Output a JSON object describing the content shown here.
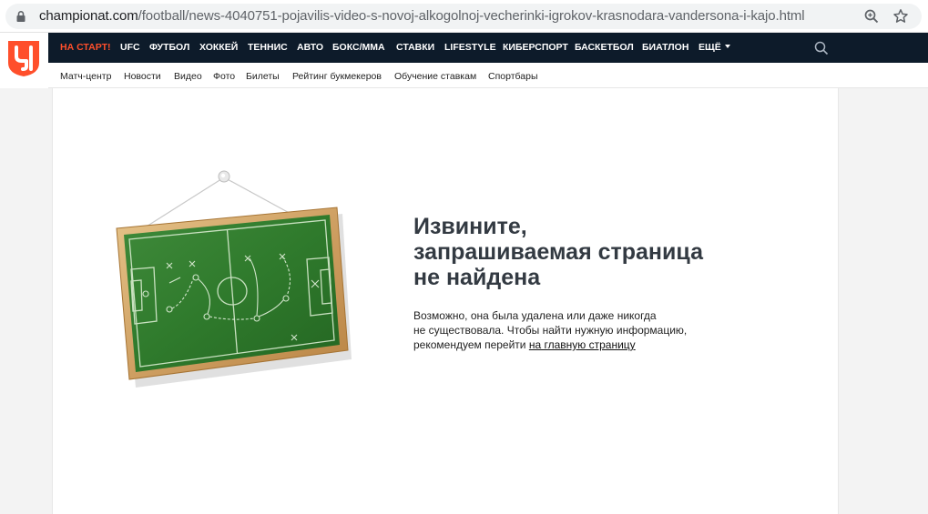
{
  "browser": {
    "url_host": "championat.com",
    "url_path": "/football/news-4040751-pojavilis-video-s-novoj-alkogolnoj-vecherinki-igrokov-krasnodara-vandersona-i-kajo.html",
    "icons": [
      "lock-icon",
      "zoom-icon",
      "star-icon"
    ]
  },
  "site": {
    "logo_icon": "championat-logo",
    "brand_color": "#ff4f2b",
    "nav_bg": "#0d1b2a",
    "nav": [
      {
        "label": "НА СТАРТ!"
      },
      {
        "label": "UFC"
      },
      {
        "label": "ФУТБОЛ"
      },
      {
        "label": "ХОККЕЙ"
      },
      {
        "label": "ТЕННИС"
      },
      {
        "label": "АВТО"
      },
      {
        "label": "БОКС/ММА"
      },
      {
        "label": "СТАВКИ"
      },
      {
        "label": "LIFESTYLE"
      },
      {
        "label": "КИБЕРСПОРТ"
      },
      {
        "label": "БАСКЕТБОЛ"
      },
      {
        "label": "БИАТЛОН"
      },
      {
        "label": "ЕЩЁ"
      }
    ],
    "subnav": [
      {
        "label": "Матч-центр"
      },
      {
        "label": "Новости"
      },
      {
        "label": "Видео"
      },
      {
        "label": "Фото"
      },
      {
        "label": "Билеты"
      },
      {
        "label": "Рейтинг букмекеров"
      },
      {
        "label": "Обучение ставкам"
      },
      {
        "label": "Спортбары"
      }
    ]
  },
  "error": {
    "title_line1": "Извините,",
    "title_line2": "запрашиваемая страница",
    "title_line3": "не найдена",
    "text_line1": "Возможно, она была удалена или даже никогда",
    "text_line2": "не существовала. Чтобы найти нужную информацию,",
    "text_line3": "рекомендуем перейти",
    "link_label": "на главную страницу",
    "illustration": "football-tactics-board"
  }
}
